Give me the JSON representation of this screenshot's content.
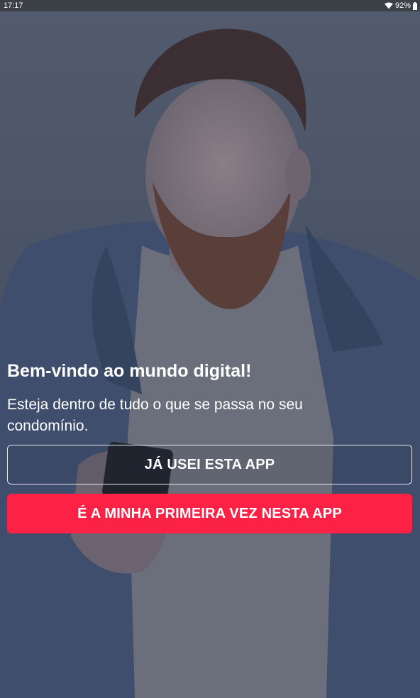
{
  "status_bar": {
    "time": "17:17",
    "battery_percent": "92%",
    "icons": [
      "wifi-icon",
      "battery-icon"
    ]
  },
  "welcome": {
    "title": "Bem-vindo ao mundo digital!",
    "subtitle": "Esteja dentro de tudo o que se passa no seu condomínio."
  },
  "buttons": {
    "existing_user": "JÁ USEI ESTA APP",
    "first_time": "É A MINHA PRIMEIRA VEZ NESTA APP"
  },
  "colors": {
    "primary": "#fb2246",
    "overlay": "#3b465a",
    "status_bar": "#3b3f46",
    "text": "#ffffff"
  }
}
